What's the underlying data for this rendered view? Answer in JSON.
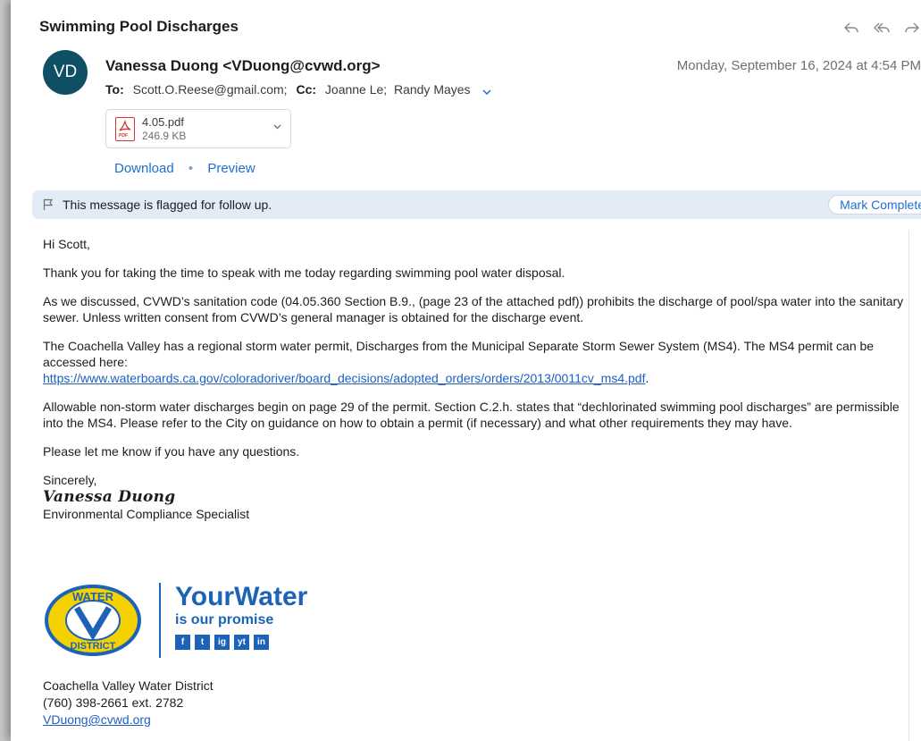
{
  "email": {
    "subject": "Swimming Pool Discharges",
    "avatar_initials": "VD",
    "sender": "Vanessa Duong <VDuong@cvwd.org>",
    "date": "Monday, September 16, 2024 at 4:54 PM",
    "to_label": "To:",
    "to": "Scott.O.Reese@gmail.com;",
    "cc_label": "Cc:",
    "cc": "Joanne Le;  Randy Mayes"
  },
  "attachment": {
    "name": "4.05.pdf",
    "size": "246.9 KB",
    "icon_label": "PDF",
    "download_label": "Download",
    "separator": "•",
    "preview_label": "Preview"
  },
  "flag": {
    "text": "This message is flagged for follow up.",
    "button": "Mark Complete"
  },
  "body": {
    "greeting": "Hi Scott,",
    "p1": "Thank you for taking the time to speak with me today regarding swimming pool water disposal.",
    "p2": "As we discussed, CVWD’s sanitation code (04.05.360 Section B.9., (page 23 of the attached pdf)) prohibits the discharge of pool/spa water into the sanitary sewer. Unless written consent from CVWD’s general manager is obtained for the discharge event.",
    "p3": "The Coachella Valley has a regional storm water permit, Discharges from the Municipal Separate Storm Sewer System (MS4). The MS4 permit can be accessed here:",
    "p3_link": "https://www.waterboards.ca.gov/coloradoriver/board_decisions/adopted_orders/orders/2013/0011cv_ms4.pdf",
    "p3_end": ".",
    "p4": "Allowable non-storm water discharges begin on page 29 of the permit. Section C.2.h. states that “dechlorinated swimming pool discharges” are permissible into the MS4. Please refer to the City on guidance on how to obtain a permit (if necessary) and what other requirements they may have.",
    "p5": "Please let me know if you have any questions.",
    "closing": "Sincerely,",
    "signature": "Vanessa Duong",
    "title": "Environmental Compliance Specialist"
  },
  "logo": {
    "seal_top": "WATER",
    "seal_bottom": "DISTRICT",
    "brand_line1": "YourWater",
    "brand_line2": "is our promise",
    "socials": [
      "f",
      "t",
      "ig",
      "yt",
      "in"
    ]
  },
  "contact": {
    "org": "Coachella Valley Water District",
    "phone": "(760) 398-2661 ext. 2782",
    "email": "VDuong@cvwd.org"
  },
  "colors": {
    "avatar": "#0e4f63",
    "link": "#1f6fd1",
    "flag_bar": "#e3ebf6",
    "brand": "#1c63b7",
    "seal_yellow": "#f3d200"
  }
}
